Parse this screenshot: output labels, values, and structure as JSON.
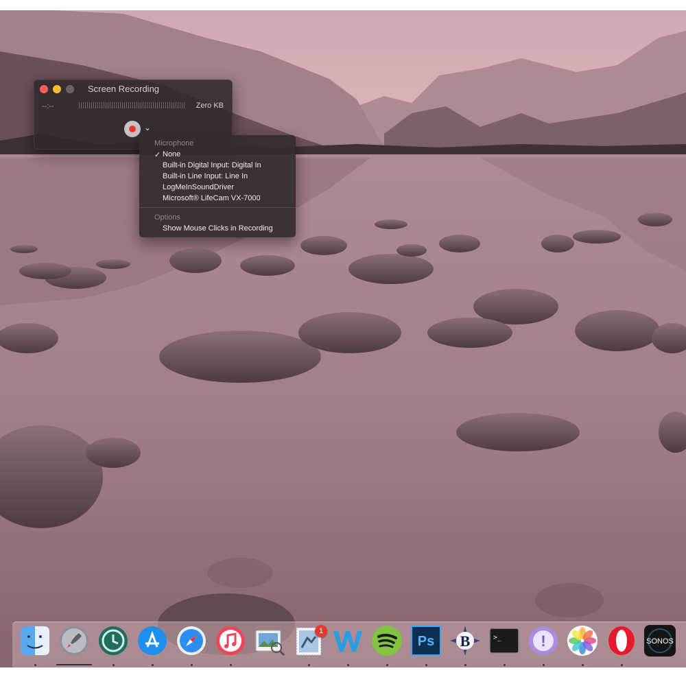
{
  "window": {
    "title": "Screen Recording",
    "elapsed_time": "--:--",
    "file_size": "Zero KB"
  },
  "menu": {
    "microphone_header": "Microphone",
    "microphone_items": [
      {
        "label": "None",
        "checked": true
      },
      {
        "label": "Built-in Digital Input: Digital In",
        "checked": false
      },
      {
        "label": "Built-in Line Input: Line In",
        "checked": false
      },
      {
        "label": "LogMeInSoundDriver",
        "checked": false
      },
      {
        "label": "Microsoft® LifeCam VX-7000",
        "checked": false
      }
    ],
    "check_mark": "✓",
    "options_header": "Options",
    "options_items": [
      {
        "label": "Show Mouse Clicks in Recording",
        "checked": false
      }
    ]
  },
  "dock": {
    "items": [
      {
        "name": "finder",
        "icon": "finder-icon",
        "running": true
      },
      {
        "name": "launchpad",
        "icon": "rocket-icon",
        "running": false
      },
      {
        "name": "time-machine",
        "icon": "clock-icon",
        "running": true
      },
      {
        "name": "app-store",
        "icon": "app-store-icon",
        "running": true
      },
      {
        "name": "safari",
        "icon": "compass-icon",
        "running": true
      },
      {
        "name": "itunes",
        "icon": "music-note-icon",
        "running": true
      },
      {
        "name": "preview",
        "icon": "preview-icon",
        "running": false
      },
      {
        "name": "mail",
        "icon": "stamp-icon",
        "running": true,
        "badge": "1"
      },
      {
        "name": "word",
        "icon": "w-icon",
        "running": true
      },
      {
        "name": "spotify",
        "icon": "spotify-icon",
        "running": true
      },
      {
        "name": "photoshop",
        "icon": "ps-icon",
        "running": true,
        "label": "Ps"
      },
      {
        "name": "bbedit",
        "icon": "b-icon",
        "running": true,
        "label": "B"
      },
      {
        "name": "terminal",
        "icon": "terminal-icon",
        "running": true,
        "label": ">_"
      },
      {
        "name": "notification",
        "icon": "exclamation-icon",
        "running": true,
        "label": "!"
      },
      {
        "name": "photos",
        "icon": "flower-icon",
        "running": true
      },
      {
        "name": "opera",
        "icon": "opera-icon",
        "running": true
      },
      {
        "name": "sonos",
        "icon": "sonos-icon",
        "running": false,
        "label": "SONOS"
      }
    ]
  },
  "colors": {
    "record": "#e8372e",
    "close": "#fc5f57",
    "minimize": "#fdbc2e"
  }
}
